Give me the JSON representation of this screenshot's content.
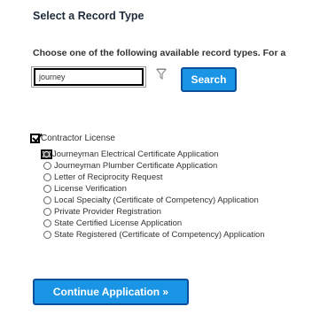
{
  "header": {
    "title": "Select a Record Type"
  },
  "instructions": {
    "text": "Choose one of the following available record types. For a"
  },
  "search": {
    "value": "journey",
    "filter_icon": "filter-icon",
    "button_label": "Search"
  },
  "category": {
    "label": "Contractor License",
    "checked": true
  },
  "record_types": [
    {
      "label": "Journeyman Electrical Certificate Application",
      "selected": true
    },
    {
      "label": "Journeyman Plumber Certificate Application",
      "selected": false
    },
    {
      "label": "Letter of Reciprocity Request",
      "selected": false
    },
    {
      "label": "License Verification",
      "selected": false
    },
    {
      "label": "Local Specialty (Certificate of Competency) Application",
      "selected": false
    },
    {
      "label": "Private Provider Registration",
      "selected": false
    },
    {
      "label": "State Certified License Application",
      "selected": false
    },
    {
      "label": "State Registered (Certificate of Competency) Application",
      "selected": false
    }
  ],
  "actions": {
    "continue_label": "Continue Application »"
  },
  "colors": {
    "button_bg": "#1a95e6",
    "button_border": "#0a4f99",
    "heading": "#1f2b3a",
    "text": "#333333"
  }
}
